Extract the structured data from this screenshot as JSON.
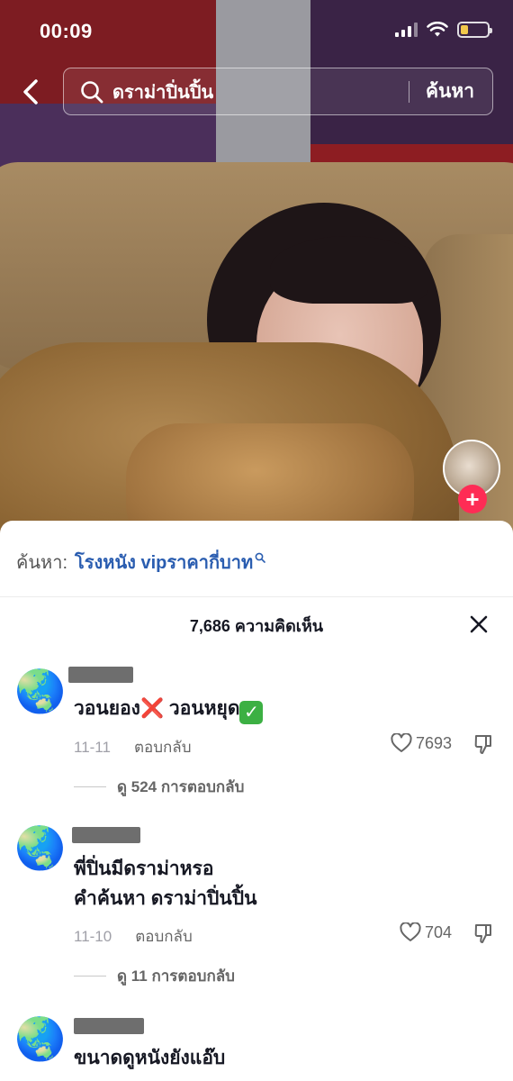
{
  "status_bar": {
    "time": "00:09"
  },
  "search": {
    "query": "ดราม่าปิ่นปิ้น",
    "submit_label": "ค้นหา"
  },
  "suggestion": {
    "label": "ค้นหา:",
    "query": "โรงหนัง vipราคากี่บาท"
  },
  "comments_header": {
    "count_text": "7,686 ความคิดเห็น"
  },
  "comments": [
    {
      "avatar": "🌏",
      "text_parts": [
        "วอนยอง",
        "❌",
        " วอนหยุด",
        "✓"
      ],
      "date": "11-11",
      "reply_label": "ตอบกลับ",
      "likes": "7693",
      "view_replies": "ดู 524 การตอบกลับ"
    },
    {
      "avatar": "🌏",
      "text_lines": [
        "พี่ปิ่นมีดราม่าหรอ",
        "คำค้นหา ดราม่าปิ่นปิ้น"
      ],
      "date": "11-10",
      "reply_label": "ตอบกลับ",
      "likes": "704",
      "view_replies": "ดู 11 การตอบกลับ"
    },
    {
      "avatar": "🌏",
      "text": "ขนาดดูหนังยังแอ๊บ"
    }
  ],
  "colors": {
    "accent": "#fe2c55",
    "link": "#2a5db0",
    "battery": "#f1c84b"
  }
}
